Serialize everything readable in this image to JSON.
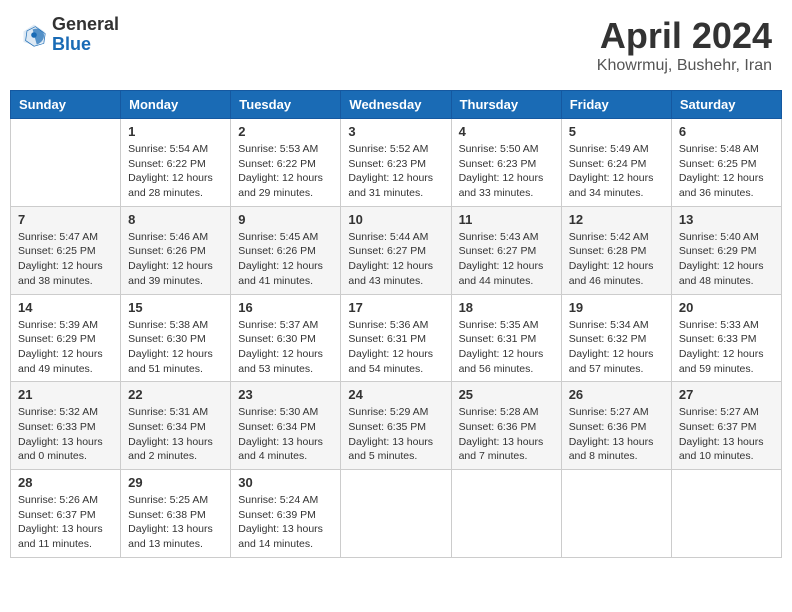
{
  "header": {
    "logo_general": "General",
    "logo_blue": "Blue",
    "month_title": "April 2024",
    "location": "Khowrmuj, Bushehr, Iran"
  },
  "calendar": {
    "days_of_week": [
      "Sunday",
      "Monday",
      "Tuesday",
      "Wednesday",
      "Thursday",
      "Friday",
      "Saturday"
    ],
    "weeks": [
      [
        {
          "day": "",
          "content": ""
        },
        {
          "day": "1",
          "content": "Sunrise: 5:54 AM\nSunset: 6:22 PM\nDaylight: 12 hours\nand 28 minutes."
        },
        {
          "day": "2",
          "content": "Sunrise: 5:53 AM\nSunset: 6:22 PM\nDaylight: 12 hours\nand 29 minutes."
        },
        {
          "day": "3",
          "content": "Sunrise: 5:52 AM\nSunset: 6:23 PM\nDaylight: 12 hours\nand 31 minutes."
        },
        {
          "day": "4",
          "content": "Sunrise: 5:50 AM\nSunset: 6:23 PM\nDaylight: 12 hours\nand 33 minutes."
        },
        {
          "day": "5",
          "content": "Sunrise: 5:49 AM\nSunset: 6:24 PM\nDaylight: 12 hours\nand 34 minutes."
        },
        {
          "day": "6",
          "content": "Sunrise: 5:48 AM\nSunset: 6:25 PM\nDaylight: 12 hours\nand 36 minutes."
        }
      ],
      [
        {
          "day": "7",
          "content": "Sunrise: 5:47 AM\nSunset: 6:25 PM\nDaylight: 12 hours\nand 38 minutes."
        },
        {
          "day": "8",
          "content": "Sunrise: 5:46 AM\nSunset: 6:26 PM\nDaylight: 12 hours\nand 39 minutes."
        },
        {
          "day": "9",
          "content": "Sunrise: 5:45 AM\nSunset: 6:26 PM\nDaylight: 12 hours\nand 41 minutes."
        },
        {
          "day": "10",
          "content": "Sunrise: 5:44 AM\nSunset: 6:27 PM\nDaylight: 12 hours\nand 43 minutes."
        },
        {
          "day": "11",
          "content": "Sunrise: 5:43 AM\nSunset: 6:27 PM\nDaylight: 12 hours\nand 44 minutes."
        },
        {
          "day": "12",
          "content": "Sunrise: 5:42 AM\nSunset: 6:28 PM\nDaylight: 12 hours\nand 46 minutes."
        },
        {
          "day": "13",
          "content": "Sunrise: 5:40 AM\nSunset: 6:29 PM\nDaylight: 12 hours\nand 48 minutes."
        }
      ],
      [
        {
          "day": "14",
          "content": "Sunrise: 5:39 AM\nSunset: 6:29 PM\nDaylight: 12 hours\nand 49 minutes."
        },
        {
          "day": "15",
          "content": "Sunrise: 5:38 AM\nSunset: 6:30 PM\nDaylight: 12 hours\nand 51 minutes."
        },
        {
          "day": "16",
          "content": "Sunrise: 5:37 AM\nSunset: 6:30 PM\nDaylight: 12 hours\nand 53 minutes."
        },
        {
          "day": "17",
          "content": "Sunrise: 5:36 AM\nSunset: 6:31 PM\nDaylight: 12 hours\nand 54 minutes."
        },
        {
          "day": "18",
          "content": "Sunrise: 5:35 AM\nSunset: 6:31 PM\nDaylight: 12 hours\nand 56 minutes."
        },
        {
          "day": "19",
          "content": "Sunrise: 5:34 AM\nSunset: 6:32 PM\nDaylight: 12 hours\nand 57 minutes."
        },
        {
          "day": "20",
          "content": "Sunrise: 5:33 AM\nSunset: 6:33 PM\nDaylight: 12 hours\nand 59 minutes."
        }
      ],
      [
        {
          "day": "21",
          "content": "Sunrise: 5:32 AM\nSunset: 6:33 PM\nDaylight: 13 hours\nand 0 minutes."
        },
        {
          "day": "22",
          "content": "Sunrise: 5:31 AM\nSunset: 6:34 PM\nDaylight: 13 hours\nand 2 minutes."
        },
        {
          "day": "23",
          "content": "Sunrise: 5:30 AM\nSunset: 6:34 PM\nDaylight: 13 hours\nand 4 minutes."
        },
        {
          "day": "24",
          "content": "Sunrise: 5:29 AM\nSunset: 6:35 PM\nDaylight: 13 hours\nand 5 minutes."
        },
        {
          "day": "25",
          "content": "Sunrise: 5:28 AM\nSunset: 6:36 PM\nDaylight: 13 hours\nand 7 minutes."
        },
        {
          "day": "26",
          "content": "Sunrise: 5:27 AM\nSunset: 6:36 PM\nDaylight: 13 hours\nand 8 minutes."
        },
        {
          "day": "27",
          "content": "Sunrise: 5:27 AM\nSunset: 6:37 PM\nDaylight: 13 hours\nand 10 minutes."
        }
      ],
      [
        {
          "day": "28",
          "content": "Sunrise: 5:26 AM\nSunset: 6:37 PM\nDaylight: 13 hours\nand 11 minutes."
        },
        {
          "day": "29",
          "content": "Sunrise: 5:25 AM\nSunset: 6:38 PM\nDaylight: 13 hours\nand 13 minutes."
        },
        {
          "day": "30",
          "content": "Sunrise: 5:24 AM\nSunset: 6:39 PM\nDaylight: 13 hours\nand 14 minutes."
        },
        {
          "day": "",
          "content": ""
        },
        {
          "day": "",
          "content": ""
        },
        {
          "day": "",
          "content": ""
        },
        {
          "day": "",
          "content": ""
        }
      ]
    ]
  }
}
